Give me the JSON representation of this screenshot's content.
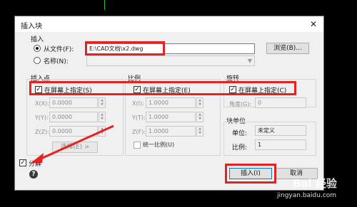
{
  "window": {
    "title": "插入块",
    "close_glyph": "✕"
  },
  "insert_source": {
    "group_label": "插入",
    "from_file_label": "从文件(F):",
    "file_path": "E:\\CAD文档\\x2.dwg",
    "browse_label": "浏览(B)...",
    "name_label": "名称(N):",
    "name_value": ""
  },
  "insertion_point": {
    "group_label": "插入点",
    "specify_on_screen": "在屏幕上指定(S)",
    "x_label": "X(X):",
    "x_value": "0.0000",
    "y_label": "Y(Y):",
    "y_value": "0.0000",
    "z_label": "Z(Z):",
    "z_value": "0.0000",
    "select_label": "选择(E) >"
  },
  "scale": {
    "group_label": "比例",
    "specify_on_screen": "在屏幕上指定(E)",
    "x_label": "X(I):",
    "x_value": "1.0000",
    "y_label": "Y(T):",
    "y_value": "1.0000",
    "z_label": "Z(F):",
    "z_value": "1.0000",
    "uniform_label": "统一比例(U)"
  },
  "rotation": {
    "group_label": "旋转",
    "specify_on_screen": "在屏幕上指定(C)",
    "angle_label": "角度(G):",
    "angle_value": "0"
  },
  "block_unit": {
    "group_label": "块单位",
    "unit_label": "单位:",
    "unit_value": "未定义",
    "factor_label": "比例:",
    "factor_value": "1"
  },
  "explode": {
    "label": "分解"
  },
  "buttons": {
    "insert": "插入(I)",
    "cancel": "取消"
  },
  "help_glyph": "?",
  "watermark": {
    "main": "Bai 经验",
    "sub": "jingyan.baidu.com"
  },
  "colors": {
    "highlight_red": "#e32222",
    "cursor_green": "#1ec81e",
    "dialog_bg": "#f0f0f0"
  }
}
